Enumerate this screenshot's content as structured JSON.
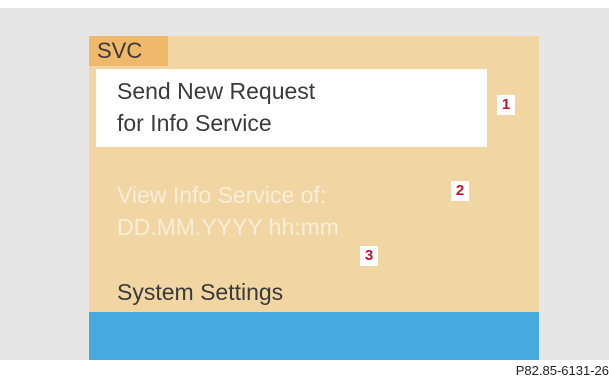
{
  "screen": {
    "tab_label": "SVC",
    "menu_items": [
      {
        "line1": "Send New Request",
        "line2": "for Info Service",
        "selected": true,
        "callout": "1"
      },
      {
        "line1": "View Info Service of:",
        "line2": "DD.MM.YYYY   hh:mm",
        "enabled": false,
        "callout": "2"
      },
      {
        "line1": "System Settings",
        "callout": "3"
      }
    ]
  },
  "figure_ref": "P82.85-6131-26",
  "colors": {
    "screen_background": "#f1d6a3",
    "tab_background": "#f0b86b",
    "selected_item_background": "#ffffff",
    "disabled_text": "#f7edd8",
    "status_bar": "#47a9dd",
    "callout_number": "#c3122a"
  }
}
